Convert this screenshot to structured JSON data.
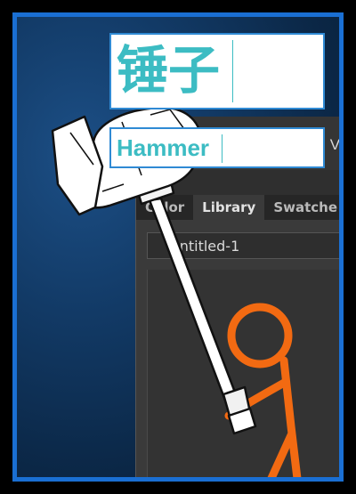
{
  "app": {
    "menu_fragment": "Vie",
    "tabs": [
      "Color",
      "Library",
      "Swatche"
    ],
    "active_tab": "Library",
    "document_select_value": "Untitled-1"
  },
  "labels": {
    "chinese": "锤子",
    "english": "Hammer"
  },
  "colors": {
    "label_text": "#3cbcc3",
    "label_border": "#2f8ad4",
    "stick_figure": "#f26a12",
    "frame_border": "#1a6fd3"
  },
  "icons": {
    "hammer": "hammer-icon",
    "stick_figure": "stick-figure-illustration"
  }
}
